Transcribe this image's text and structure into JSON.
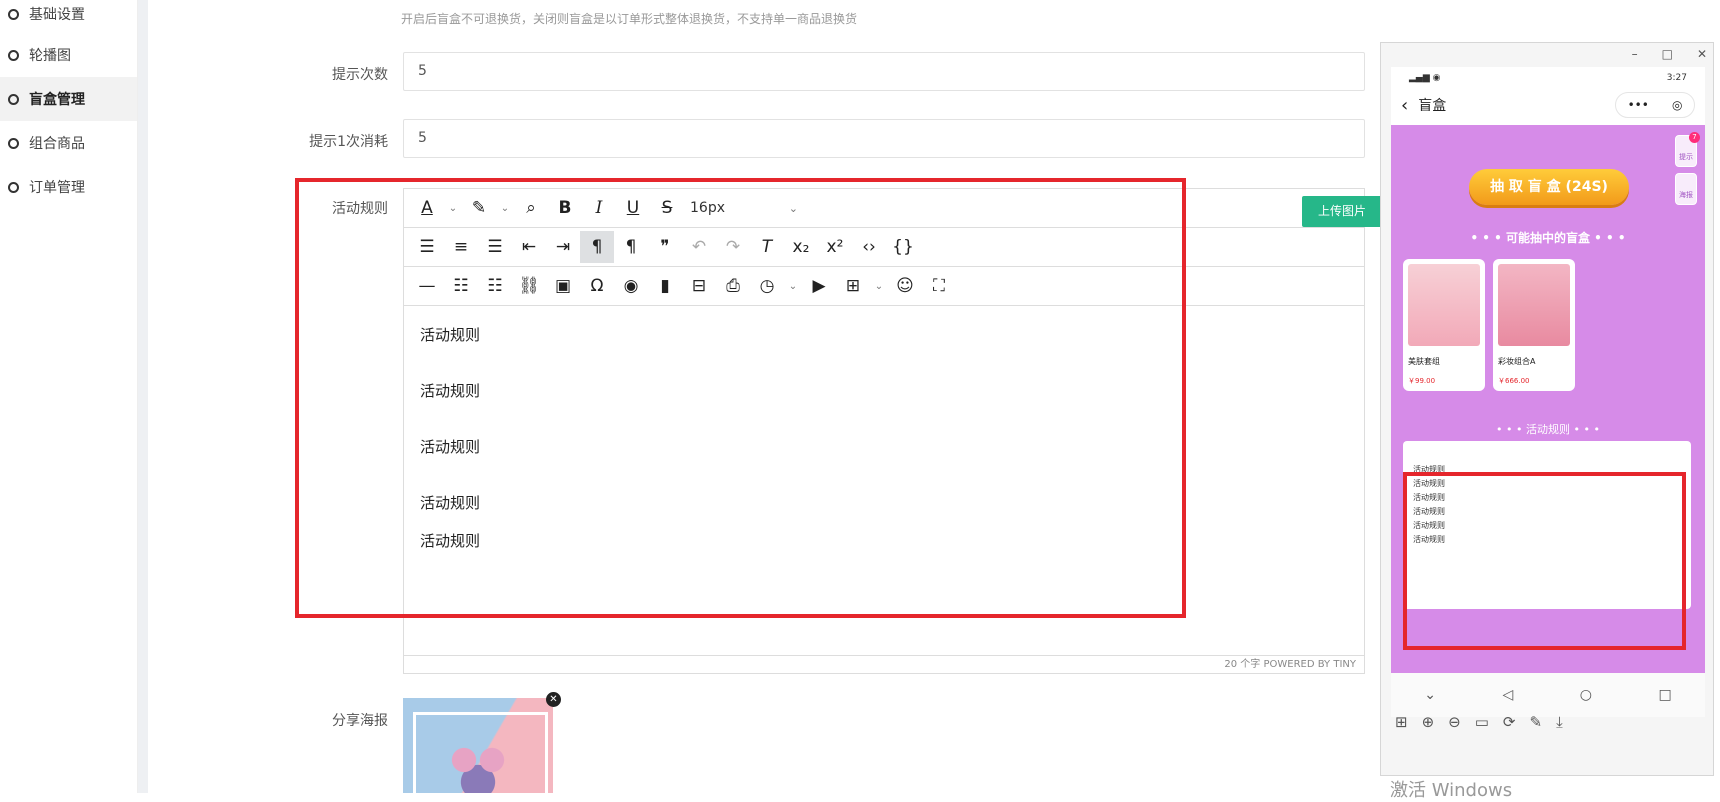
{
  "sidebar": {
    "items": [
      {
        "label": "基础设置"
      },
      {
        "label": "轮播图"
      },
      {
        "label": "盲盒管理"
      },
      {
        "label": "组合商品"
      },
      {
        "label": "订单管理"
      }
    ]
  },
  "form": {
    "hint": "开启后盲盒不可退换货，关闭则盲盒是以订单形式整体退换货，不支持单一商品退换货",
    "tip_count_label": "提示次数",
    "tip_count_value": "5",
    "tip_cost_label": "提示1次消耗",
    "tip_cost_value": "5",
    "rules_label": "活动规则",
    "poster_label": "分享海报",
    "upload_label": "上传图片"
  },
  "editor": {
    "font_size": "16px",
    "paragraphs": [
      "活动规则",
      "活动规则",
      "活动规则",
      "活动规则",
      "活动规则"
    ],
    "status": "20 个字  POWERED BY TINY"
  },
  "phone": {
    "time": "3:27",
    "title": "盲盒",
    "draw_button": "抽 取 盲 盒 (24S)",
    "hint_badge": "提示",
    "hint_count": "7",
    "poster_badge": "海报",
    "possible_title": "• • •  可能抽中的盲盒  • • •",
    "cards": [
      {
        "name": "美肤套组",
        "price": "￥99.00"
      },
      {
        "name": "彩妆组合A",
        "price": "￥666.00"
      }
    ],
    "rules_title": "• • •  活动规则  • • •",
    "rules_lines": [
      "活动规则",
      "活动规则",
      "活动规则",
      "活动规则",
      "活动规则",
      "活动规则"
    ]
  },
  "watermark": "激活 Windows"
}
